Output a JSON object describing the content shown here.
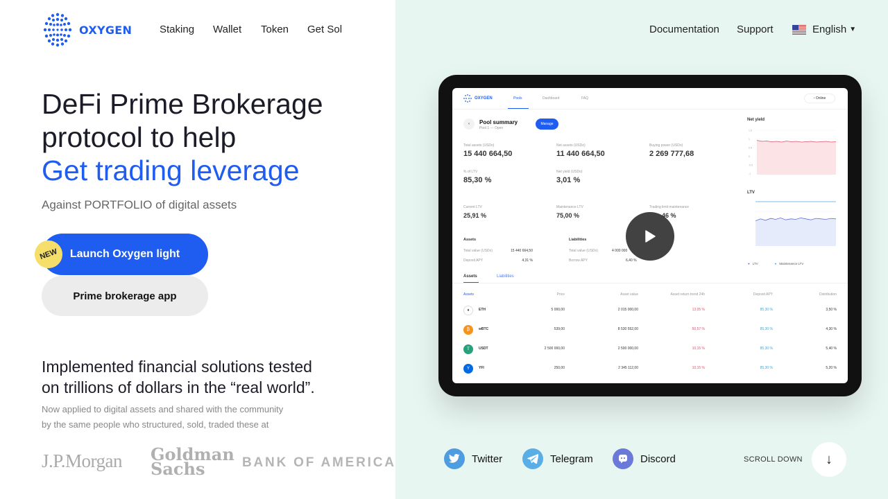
{
  "brand": {
    "logo_text": "OXYGEN",
    "accent": "#1f5cf0"
  },
  "nav": {
    "links": [
      "Staking",
      "Wallet",
      "Token",
      "Get Sol"
    ],
    "documentation": "Documentation",
    "support": "Support",
    "language": "English"
  },
  "hero": {
    "line1": "DeFi Prime Brokerage",
    "line2": "protocol to help",
    "line3": "Get trading leverage",
    "subtitle": "Against PORTFOLIO of digital assets"
  },
  "buttons": {
    "new_badge": "NEW",
    "launch": "Launch Oxygen light",
    "prime": "Prime brokerage app"
  },
  "implemented": {
    "line1": "Implemented financial solutions tested",
    "line2": "on trillions of dollars in the “real world”.",
    "sub1": "Now applied to digital assets and shared with the community",
    "sub2": "by the same people who structured, sold, traded these at"
  },
  "brands": [
    "J.P.Morgan",
    "Goldman",
    "Sachs",
    "BANK OF AMERICA"
  ],
  "tablet": {
    "logo": "OXYGEN",
    "tabs": [
      "Pools",
      "Dashboard",
      "FAQ"
    ],
    "status": "Online",
    "pool_title": "Pool summary",
    "pool_sub": "Pool 1 — Open",
    "manage": "Manage",
    "stats": [
      {
        "label": "Total assets (USDo)",
        "value": "15 440 664,50"
      },
      {
        "label": "Net assets (USDo)",
        "value": "11 440 664,50"
      },
      {
        "label": "Buying power (USDo)",
        "value": "2 269 777,68"
      },
      {
        "label": "% of LTV",
        "value": "85,30 %"
      },
      {
        "label": "Net yield (USDo)",
        "value": "3,01 %"
      },
      {
        "label": "Current LTV",
        "value": "25,91 %"
      },
      {
        "label": "Maintenance LTV",
        "value": "75,00 %"
      },
      {
        "label": "Trading limit maintenance",
        "value": "46 %"
      }
    ],
    "assets_head": "Assets",
    "liabilities_head": "Liabilities",
    "assets_rows": [
      {
        "label": "Total value (USDo)",
        "value": "15 440 664,50"
      },
      {
        "label": "Deposit APY",
        "value": "4,31 %"
      }
    ],
    "liab_rows": [
      {
        "label": "Total value (USDo)",
        "value": "4 000 000"
      },
      {
        "label": "Borrow APY",
        "value": "6,40 %"
      }
    ],
    "net_yield": "Net yield",
    "ltv": "LTV",
    "legend": [
      "LTV",
      "Maintenance LTV"
    ],
    "table_tabs": [
      "Assets",
      "Liabilities"
    ],
    "table_cols": [
      "Assets",
      "Price",
      "Asset value",
      "Asset return trend 24h",
      "Deposit APY",
      "Distribution"
    ],
    "table_rows": [
      {
        "name": "ETH",
        "price": "5 000,00",
        "value": "2 015 000,00",
        "change": "13,05 %",
        "apy": "85,30 %",
        "dist": "3,50 %",
        "color": "#627eea"
      },
      {
        "name": "wBTC",
        "price": "539,00",
        "value": "8 530 552,00",
        "change": "50,57 %",
        "apy": "85,30 %",
        "dist": "4,30 %",
        "color": "#f7931a"
      },
      {
        "name": "USDT",
        "price": "2 500 000,00",
        "value": "2 500 000,00",
        "change": "10,15 %",
        "apy": "85,30 %",
        "dist": "5,40 %",
        "color": "#26a17b"
      },
      {
        "name": "YFI",
        "price": "250,00",
        "value": "2 345 112,00",
        "change": "10,15 %",
        "apy": "85,30 %",
        "dist": "5,20 %",
        "color": "#006ae3"
      }
    ],
    "net_yield_axis": [
      "1.5",
      "1",
      "0.5",
      "0",
      "-0.5",
      "-1"
    ],
    "net_yield_series": [
      9.5,
      9.2,
      9.3,
      9.1,
      9.2,
      9.0,
      9.3,
      9.1,
      9.2,
      9.0,
      9.1,
      9.2,
      9.0,
      9.1,
      9.2,
      9.0,
      9.1
    ],
    "ltv_series": [
      5.2,
      5.6,
      5.3,
      5.7,
      5.5,
      5.8,
      5.4,
      5.6,
      5.5,
      5.8,
      5.6,
      5.4,
      5.7,
      5.6,
      5.5,
      5.7,
      5.6
    ]
  },
  "social": [
    "Twitter",
    "Telegram",
    "Discord"
  ],
  "social_colors": [
    "#4d9de0",
    "#5aaee6",
    "#6b7ad8"
  ],
  "scroll_down": "SCROLL DOWN"
}
